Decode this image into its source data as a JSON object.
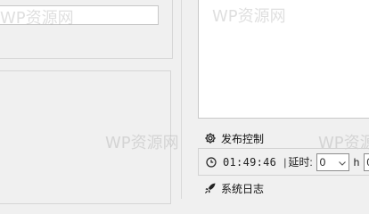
{
  "watermark": "WP资源网",
  "publish": {
    "title": "发布控制",
    "time": "01:49:46",
    "separator": "|",
    "delay_label": "延时:",
    "delay_hours": "0",
    "hours_unit": "h",
    "delay_minutes": "0"
  },
  "log": {
    "title": "系统日志"
  },
  "icons": {
    "publish": "gear-icon",
    "clock": "clock-icon",
    "log": "rocket-icon",
    "dropdown": "chevron-down-icon"
  }
}
